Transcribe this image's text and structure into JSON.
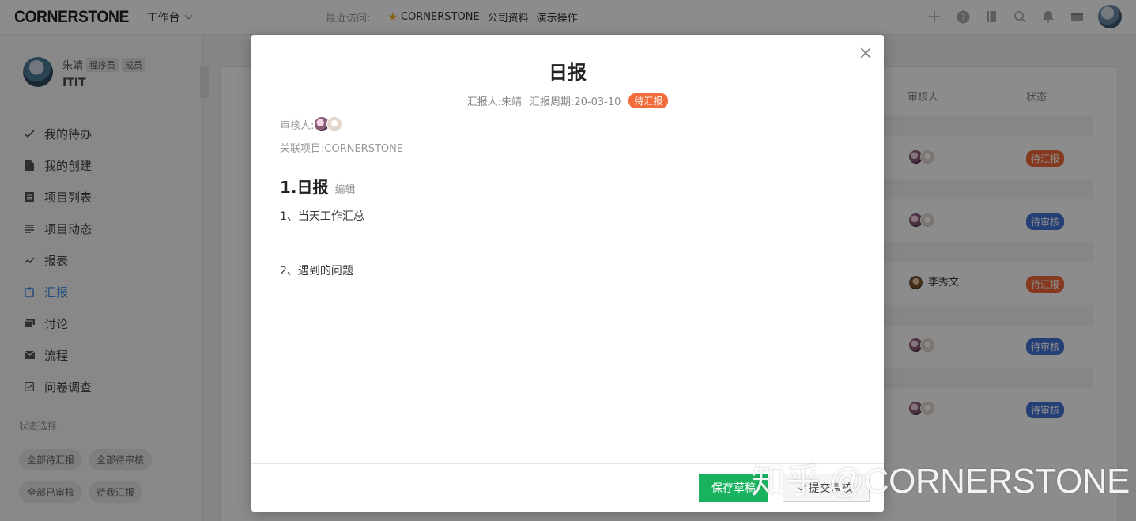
{
  "topbar": {
    "logo": "CORNERSTONE",
    "workbench": "工作台",
    "recent_label": "最近访问:",
    "recent_items": [
      "CORNERSTONE",
      "公司资料",
      "演示操作"
    ],
    "icons": [
      "plus-icon",
      "help-icon",
      "book-icon",
      "search-icon",
      "bell-icon",
      "inbox-icon"
    ]
  },
  "sidebar": {
    "user_name": "朱靖",
    "tags": [
      "程序员",
      "成员"
    ],
    "org": "ITIT",
    "nav": [
      {
        "label": "我的待办",
        "icon": "check-icon"
      },
      {
        "label": "我的创建",
        "icon": "file-icon"
      },
      {
        "label": "项目列表",
        "icon": "list-icon"
      },
      {
        "label": "项目动态",
        "icon": "lines-icon"
      },
      {
        "label": "报表",
        "icon": "trend-icon"
      },
      {
        "label": "汇报",
        "icon": "clipboard-icon"
      },
      {
        "label": "讨论",
        "icon": "chat-icon"
      },
      {
        "label": "流程",
        "icon": "mail-icon"
      },
      {
        "label": "问卷调查",
        "icon": "checkbox-icon"
      }
    ],
    "active_index": 5,
    "status_title": "状态选择",
    "chips": [
      "全部待汇报",
      "全部待审核",
      "全部已审核",
      "待我汇报"
    ]
  },
  "table": {
    "headers": {
      "reviewer": "审核人",
      "status": "状态"
    },
    "rows": [
      {
        "reviewer_name": "",
        "status": "待汇报",
        "color": "orange"
      },
      {
        "reviewer_name": "",
        "status": "待审核",
        "color": "blue"
      },
      {
        "reviewer_name": "李秀文",
        "status": "待汇报",
        "color": "orange"
      },
      {
        "reviewer_name": "",
        "status": "待审核",
        "color": "blue"
      },
      {
        "reviewer_name": "",
        "status": "待审核",
        "color": "blue"
      }
    ]
  },
  "modal": {
    "title": "日报",
    "reporter_label": "汇报人:",
    "reporter": "朱靖",
    "period_label": "汇报周期:",
    "period": "20-03-10",
    "status": "待汇报",
    "reviewer_label": "审核人:",
    "project_label": "关联项目:",
    "project": "CORNERSTONE",
    "section_title": "1.日报",
    "edit": "编辑",
    "line1": "1、当天工作汇总",
    "line2": "2、遇到的问题",
    "save_label": "保存草稿",
    "submit_label": "提交审核"
  },
  "watermark": "知乎 @CORNERSTONE",
  "colors": {
    "accent": "#3b8ee8",
    "orange": "#f26b3a",
    "blue": "#4173d8",
    "green": "#19b35f"
  }
}
